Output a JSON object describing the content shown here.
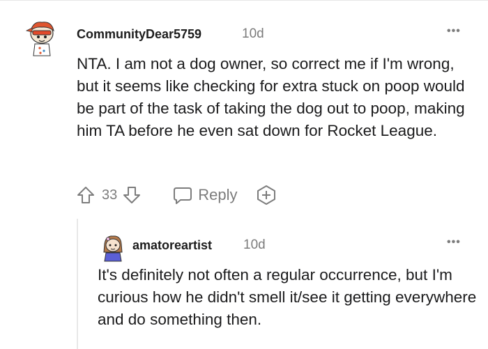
{
  "comments": [
    {
      "username": "CommunityDear5759",
      "time": "10d",
      "text": "NTA. I am not a dog owner, so correct me if I'm wrong, but it seems like checking for extra stuck on poop would be part of the task of taking the dog out to poop, making him TA before he even sat down for Rocket League.",
      "votes": "33",
      "reply_label": "Reply",
      "icons": {
        "upvote": "upvote-arrow-icon",
        "downvote": "downvote-arrow-icon",
        "reply": "speech-bubble-icon",
        "award": "award-plus-icon",
        "more": "more-dots-icon"
      }
    },
    {
      "username": "amatoreartist",
      "time": "10d",
      "text": "It's definitely not often a regular occurrence, but I'm curious how he didn't smell it/see it getting everywhere and do something then."
    }
  ],
  "more_label": "•••"
}
